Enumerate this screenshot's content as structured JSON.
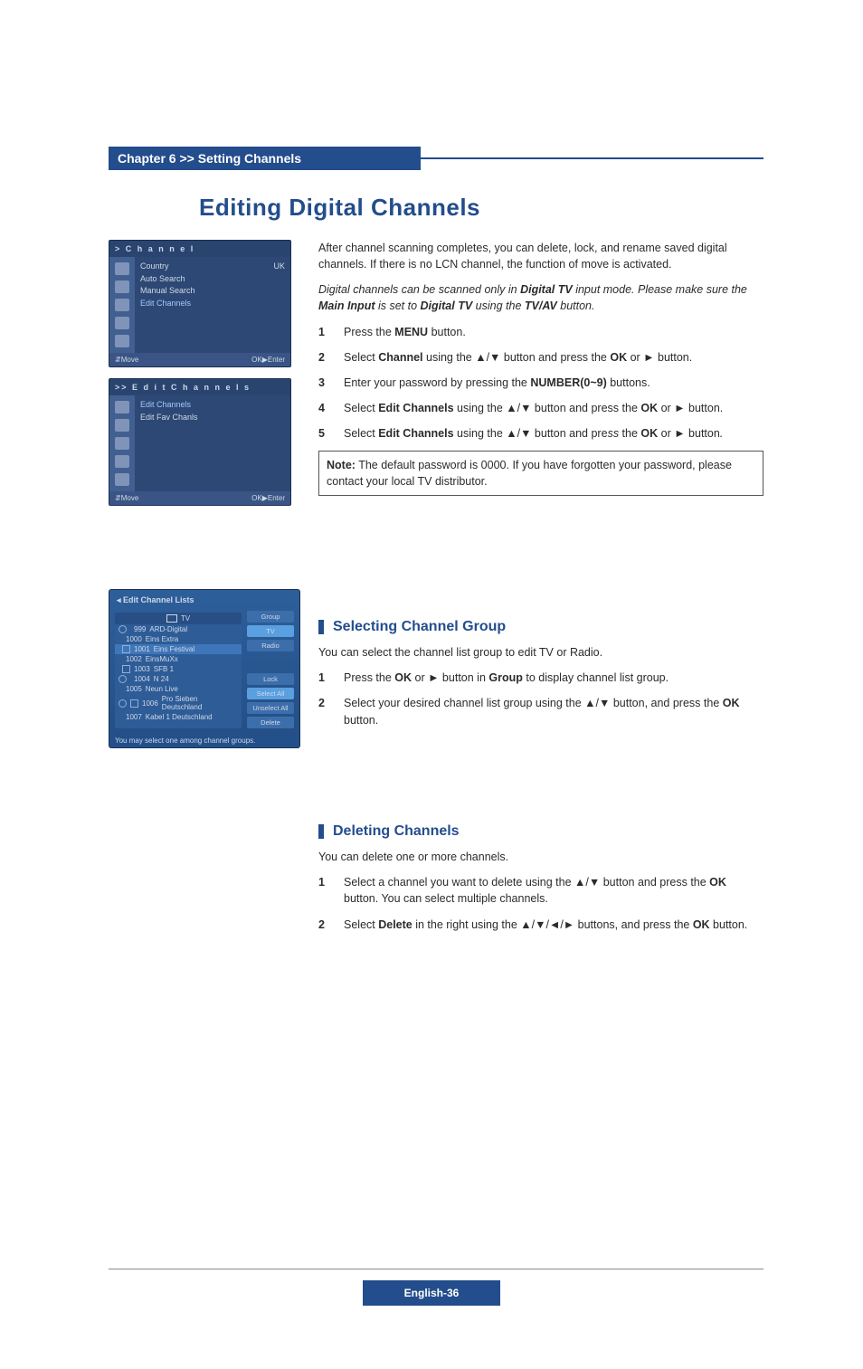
{
  "chapter": {
    "label": "Chapter 6 >> Setting Channels"
  },
  "section_title": "Editing Digital Channels",
  "intro": {
    "p1": "After channel scanning completes, you can delete, lock, and rename saved digital channels. If there is no LCN channel, the function of move is activated.",
    "p2_pre": "Digital channels can be scanned only in ",
    "p2_b1": "Digital TV",
    "p2_mid1": " input mode. Please make sure the ",
    "p2_b2": "Main Input",
    "p2_mid2": " is set to ",
    "p2_b3": "Digital TV",
    "p2_mid3": " using the ",
    "p2_b4": "TV/AV",
    "p2_end": " button."
  },
  "steps1": {
    "n1": "1",
    "t1_pre": "Press the ",
    "t1_b": "MENU",
    "t1_post": " button.",
    "n2": "2",
    "t2_pre": "Select ",
    "t2_b1": "Channel",
    "t2_mid": " using the ▲/▼ button and press the ",
    "t2_b2": "OK",
    "t2_post": " or ► button.",
    "n3": "3",
    "t3_pre": "Enter your password by pressing the ",
    "t3_b": "NUMBER(0~9)",
    "t3_post": " buttons.",
    "n4": "4",
    "t4_pre": "Select ",
    "t4_b1": "Edit Channels",
    "t4_mid": " using the ▲/▼ button and press the ",
    "t4_b2": "OK",
    "t4_post": " or ► button.",
    "n5": "5",
    "t5_pre": "Select ",
    "t5_b1": "Edit Channels",
    "t5_mid": " using the ▲/▼ button and pre",
    "t5_i": "ss",
    "t5_mid2": " the ",
    "t5_b2": "OK",
    "t5_post": " or ► button",
    "t5_end": "."
  },
  "note": {
    "label": "Note:",
    "text": " The default password is 0000. If you have forgotten your password, please contact your local TV distributor."
  },
  "menu1": {
    "title": ">  C h a n n e l",
    "rows": {
      "r1": "Country",
      "r1v": "UK",
      "r2": "Auto Search",
      "r3": "Manual Search",
      "r4": "Edit Channels"
    },
    "foot_move": "Move",
    "foot_keys": "OK",
    "foot_enter": "Enter"
  },
  "menu2": {
    "title": ">>  E d i t   C h a n n e l s",
    "rows": {
      "r1": "Edit Channels",
      "r2": "Edit Fav Chanls"
    },
    "foot_move": "Move",
    "foot_keys": "OK",
    "foot_enter": "Enter"
  },
  "sub1": {
    "title": "Selecting Channel Group",
    "p": "You can select the channel list group to edit TV or Radio.",
    "n1": "1",
    "t1_pre": "Press the ",
    "t1_b1": "OK",
    "t1_mid": " or ► button in ",
    "t1_b2": "Group",
    "t1_post": " to display channel list group.",
    "n2": "2",
    "t2_pre": "Select your desired channel list group using the ▲/▼ button, and press the ",
    "t2_b": "OK",
    "t2_post": " button."
  },
  "sub2": {
    "title": "Deleting Channels",
    "p": "You can delete one or more channels.",
    "n1": "1",
    "t1_pre": "Select a channel you want to delete using the ▲/▼ button and press the ",
    "t1_b": "OK",
    "t1_post": " button. You can select multiple channels.",
    "n2": "2",
    "t2_pre": "Select ",
    "t2_b1": "Delete",
    "t2_mid": " in the right using the ▲/▼/◄/► buttons, and press the ",
    "t2_b2": "OK",
    "t2_post": " button."
  },
  "mock2": {
    "title": "◂ Edit Channel Lists",
    "tvtab": "TV",
    "side": {
      "group": "Group",
      "tv": "TV",
      "radio": "Radio",
      "lock": "Lock",
      "selectall": "Select All",
      "unselectall": "Unselect All",
      "delete": "Delete"
    },
    "rows": {
      "r0n": "999",
      "r0t": "ARD-Digital",
      "r1n": "1000",
      "r1t": "Eins Extra",
      "r2n": "1001",
      "r2t": "Eins Festival",
      "r3n": "1002",
      "r3t": "EinsMuXx",
      "r4n": "1003",
      "r4t": "SFB 1",
      "r5n": "1004",
      "r5t": "N 24",
      "r6n": "1005",
      "r6t": "Neun Live",
      "r7n": "1006",
      "r7t": "Pro Sieben Deutschland",
      "r8n": "1007",
      "r8t": "Kabel 1 Deutschland"
    },
    "foot": "You may select one among channel groups."
  },
  "footer": {
    "text": "English-36"
  }
}
